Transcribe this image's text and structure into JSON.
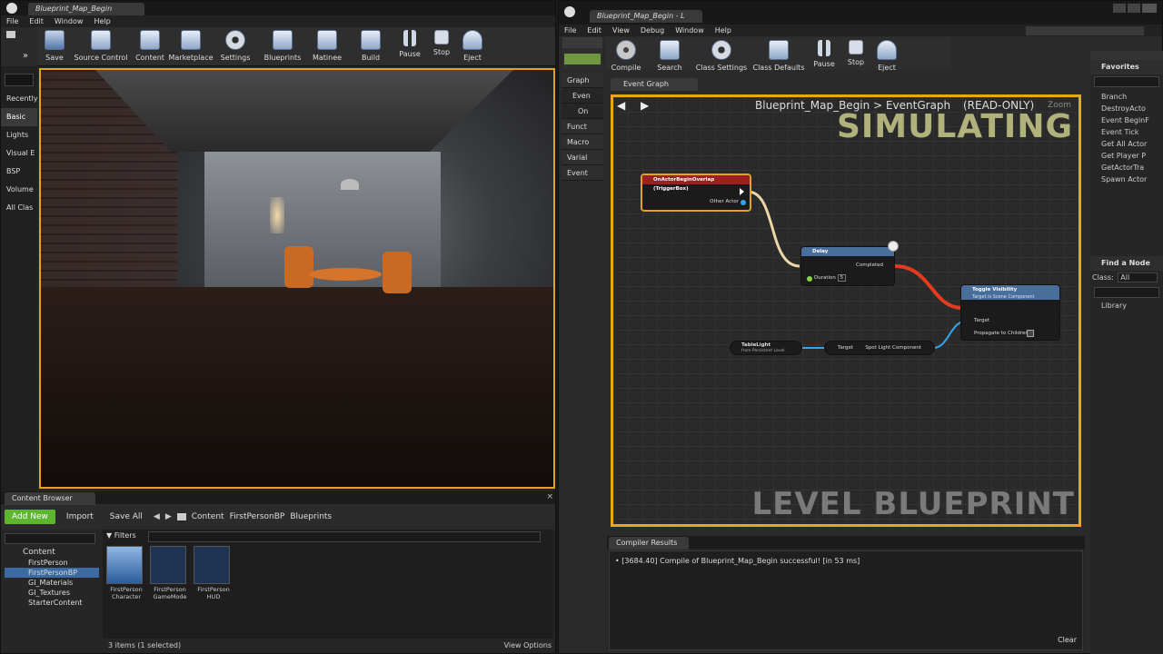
{
  "left_window": {
    "tab_title": "Blueprint_Map_Begin",
    "menu": [
      "File",
      "Edit",
      "Window",
      "Help"
    ],
    "toolbar": [
      {
        "label": "Save",
        "icon": "save-icon"
      },
      {
        "label": "Source Control",
        "icon": "source-control-icon"
      },
      {
        "label": "Content",
        "icon": "content-icon"
      },
      {
        "label": "Marketplace",
        "icon": "marketplace-icon"
      },
      {
        "label": "Settings",
        "icon": "settings-icon"
      },
      {
        "label": "Blueprints",
        "icon": "blueprints-icon"
      },
      {
        "label": "Matinee",
        "icon": "matinee-icon"
      },
      {
        "label": "Build",
        "icon": "build-icon"
      },
      {
        "label": "Pause",
        "icon": "pause-icon"
      },
      {
        "label": "Stop",
        "icon": "stop-icon"
      },
      {
        "label": "Eject",
        "icon": "eject-icon"
      }
    ],
    "modes": [
      "Recently",
      "Basic",
      "Lights",
      "Visual E",
      "BSP",
      "Volume",
      "All Clas"
    ]
  },
  "content_browser": {
    "tab": "Content Browser",
    "add_new": "Add New",
    "import": "Import",
    "save_all": "Save All",
    "breadcrumb": [
      "Content",
      "FirstPersonBP",
      "Blueprints"
    ],
    "filters": "Filters",
    "tree": [
      "Content",
      "FirstPerson",
      "FirstPersonBP",
      "GI_Materials",
      "GI_Textures",
      "StarterContent"
    ],
    "assets": [
      {
        "name": "FirstPerson Character"
      },
      {
        "name": "FirstPerson GameMode"
      },
      {
        "name": "FirstPerson HUD"
      }
    ],
    "status": "3 items (1 selected)",
    "view_options": "View Options"
  },
  "bp_window": {
    "tab_title": "Blueprint_Map_Begin - L",
    "menu": [
      "File",
      "Edit",
      "View",
      "Debug",
      "Window",
      "Help"
    ],
    "toolbar": [
      {
        "label": "Compile",
        "icon": "compile-icon"
      },
      {
        "label": "Search",
        "icon": "search-icon"
      },
      {
        "label": "Class Settings",
        "icon": "class-settings-icon"
      },
      {
        "label": "Class Defaults",
        "icon": "class-defaults-icon"
      },
      {
        "label": "Pause",
        "icon": "pause-icon"
      },
      {
        "label": "Stop",
        "icon": "stop-icon"
      },
      {
        "label": "Eject",
        "icon": "eject-icon"
      }
    ],
    "graph_tab": "Event Graph",
    "graph_title_left": "Blueprint_Map_Begin",
    "graph_title_sep": ">",
    "graph_title_right": "EventGraph",
    "read_only": "(READ-ONLY)",
    "zoom": "Zoom",
    "simulating": "SIMULATING",
    "watermark": "LEVEL BLUEPRINT",
    "left_items": [
      "Graph",
      "Even",
      "On",
      "Funct",
      "Macro",
      "Varial",
      "Event"
    ],
    "nodes": {
      "overlap": {
        "title": "OnActorBeginOverlap (TriggerBox)",
        "pin": "Other Actor"
      },
      "delay": {
        "title": "Delay",
        "completed": "Completed",
        "duration": "Duration",
        "duration_val": "5"
      },
      "toggle": {
        "title": "Toggle Visibility",
        "subtitle": "Target is Scene Component",
        "target": "Target",
        "propagate": "Propagate to Children"
      },
      "tablelight": {
        "title": "TableLight",
        "subtitle": "from Persistent Level"
      },
      "spot": {
        "target": "Target",
        "out": "Spot Light Component"
      }
    },
    "favorites": {
      "title": "Favorites",
      "items": [
        "Branch",
        "DestroyActo",
        "Event BeginF",
        "Event Tick",
        "Get All Actor",
        "Get Player P",
        "GetActorTra",
        "Spawn Actor"
      ]
    },
    "find_node": {
      "title": "Find a Node",
      "class_label": "Class:",
      "class_value": "All",
      "library": "Library"
    },
    "compiler": {
      "tab": "Compiler Results",
      "message": "[3684.40] Compile of Blueprint_Map_Begin successful! [in 53 ms]",
      "clear": "Clear"
    }
  }
}
